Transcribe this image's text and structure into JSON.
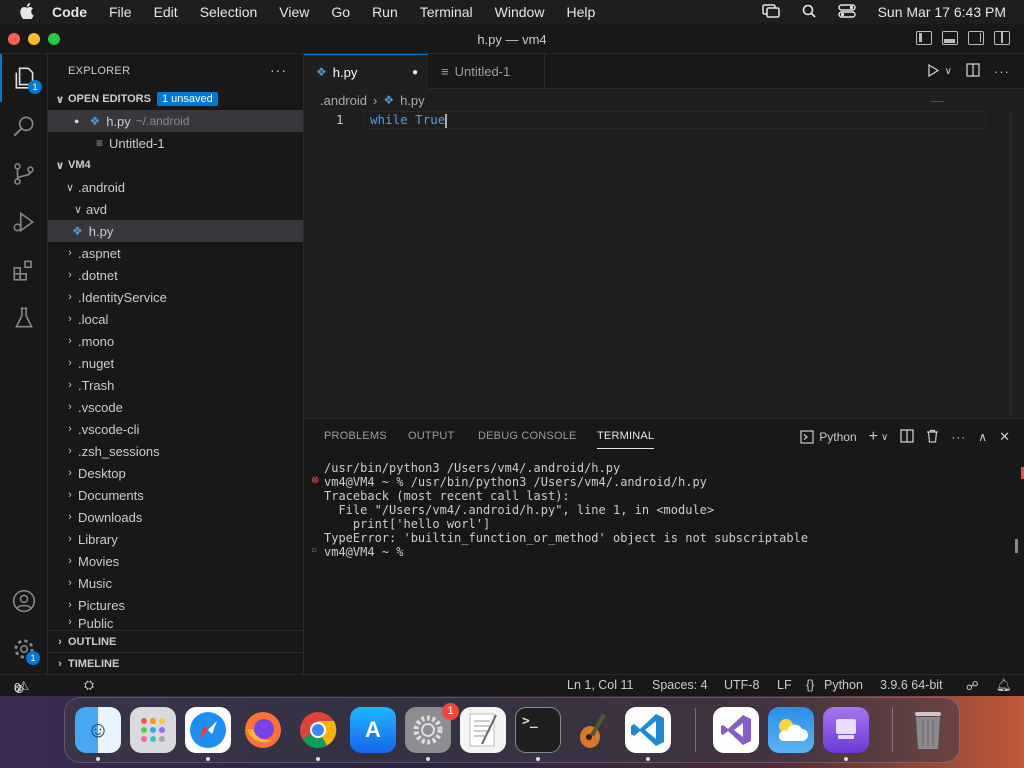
{
  "menubar": {
    "items": [
      "Code",
      "File",
      "Edit",
      "Selection",
      "View",
      "Go",
      "Run",
      "Terminal",
      "Window",
      "Help"
    ],
    "clock": "Sun Mar 17  6:43 PM"
  },
  "window": {
    "title": "h.py — vm4"
  },
  "activity": {
    "explorer_badge": "1",
    "settings_badge": "1"
  },
  "sidebar": {
    "header": "EXPLORER",
    "open_editors": {
      "label": "OPEN EDITORS",
      "badge": "1 unsaved",
      "files": [
        {
          "name": "h.py",
          "path": "~/.android"
        },
        {
          "name": "Untitled-1"
        }
      ]
    },
    "workspace": "VM4",
    "tree": [
      ".android",
      "avd",
      "h.py",
      ".aspnet",
      ".dotnet",
      ".IdentityService",
      ".local",
      ".mono",
      ".nuget",
      ".Trash",
      ".vscode",
      ".vscode-cli",
      ".zsh_sessions",
      "Desktop",
      "Documents",
      "Downloads",
      "Library",
      "Movies",
      "Music",
      "Pictures",
      "Public"
    ],
    "outline": "OUTLINE",
    "timeline": "TIMELINE"
  },
  "tabs": [
    {
      "label": "h.py"
    },
    {
      "label": "Untitled-1"
    }
  ],
  "breadcrumb": {
    "folder": ".android",
    "file": "h.py"
  },
  "editor": {
    "line_number": "1",
    "keyword": "while",
    "value": "True"
  },
  "panel": {
    "tabs": [
      "PROBLEMS",
      "OUTPUT",
      "DEBUG CONSOLE",
      "TERMINAL"
    ],
    "shell_label": "Python",
    "terminal_lines": [
      "/usr/bin/python3 /Users/vm4/.android/h.py",
      "vm4@VM4 ~ % /usr/bin/python3 /Users/vm4/.android/h.py",
      "Traceback (most recent call last):",
      "  File \"/Users/vm4/.android/h.py\", line 1, in <module>",
      "    print['hello worl']",
      "TypeError: 'builtin_function_or_method' object is not subscriptable",
      "vm4@VM4 ~ % "
    ]
  },
  "statusbar": {
    "errors": "0",
    "warnings": "0",
    "position": "Ln 1, Col 11",
    "spaces": "Spaces: 4",
    "encoding": "UTF-8",
    "eol": "LF",
    "language": "Python",
    "interpreter": "3.9.6 64-bit"
  },
  "dock": {
    "settings_badge": "1"
  },
  "colors": {
    "accent": "#0078d4",
    "error": "#f14c4c",
    "keyword": "#569cd6"
  }
}
